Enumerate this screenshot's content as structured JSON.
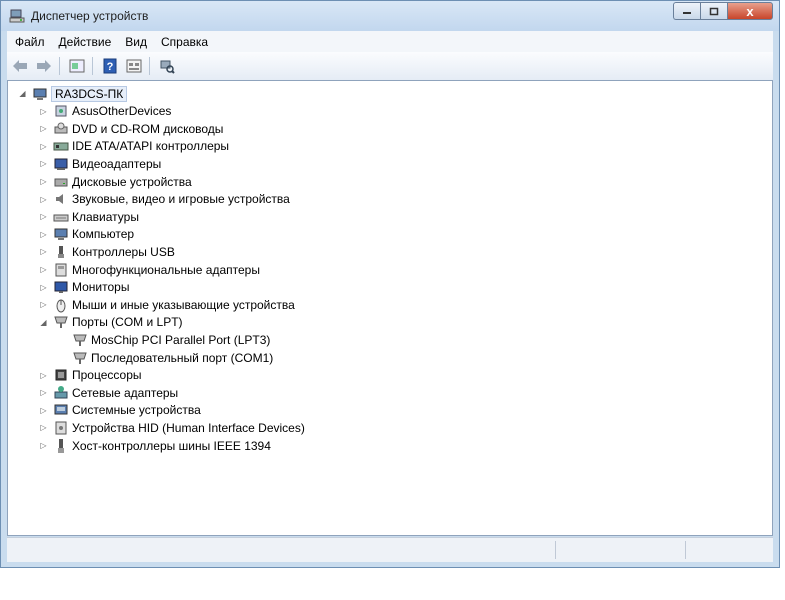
{
  "window": {
    "title": "Диспетчер устройств",
    "close_glyph": "x",
    "accent": "#c9dcee"
  },
  "menu": [
    "Файл",
    "Действие",
    "Вид",
    "Справка"
  ],
  "toolbar": {
    "buttons": [
      "back-icon",
      "forward-icon",
      "properties-icon",
      "help-icon",
      "view-icon",
      "scan-hardware-icon"
    ]
  },
  "tree": {
    "root": {
      "label": "RA3DCS-ПК",
      "expanded": true
    },
    "items": [
      {
        "label": "AsusOtherDevices",
        "icon": "device-icon",
        "expanded": false
      },
      {
        "label": "DVD и CD-ROM дисководы",
        "icon": "dvd-drive-icon",
        "expanded": false
      },
      {
        "label": "IDE ATA/ATAPI контроллеры",
        "icon": "ide-controller-icon",
        "expanded": false
      },
      {
        "label": "Видеоадаптеры",
        "icon": "display-adapter-icon",
        "expanded": false
      },
      {
        "label": "Дисковые устройства",
        "icon": "disk-drive-icon",
        "expanded": false
      },
      {
        "label": "Звуковые, видео и игровые устройства",
        "icon": "sound-icon",
        "expanded": false
      },
      {
        "label": "Клавиатуры",
        "icon": "keyboard-icon",
        "expanded": false
      },
      {
        "label": "Компьютер",
        "icon": "computer-icon",
        "expanded": false
      },
      {
        "label": "Контроллеры USB",
        "icon": "usb-icon",
        "expanded": false
      },
      {
        "label": "Многофункциональные адаптеры",
        "icon": "multifunction-adapter-icon",
        "expanded": false
      },
      {
        "label": "Мониторы",
        "icon": "monitor-icon",
        "expanded": false
      },
      {
        "label": "Мыши и иные указывающие устройства",
        "icon": "mouse-icon",
        "expanded": false
      },
      {
        "label": "Порты (COM и LPT)",
        "icon": "port-icon",
        "expanded": true,
        "children": [
          {
            "label": "MosChip PCI Parallel Port (LPT3)",
            "icon": "port-icon"
          },
          {
            "label": "Последовательный порт (COM1)",
            "icon": "port-icon"
          }
        ]
      },
      {
        "label": "Процессоры",
        "icon": "processor-icon",
        "expanded": false
      },
      {
        "label": "Сетевые адаптеры",
        "icon": "network-adapter-icon",
        "expanded": false
      },
      {
        "label": "Системные устройства",
        "icon": "system-device-icon",
        "expanded": false
      },
      {
        "label": "Устройства HID (Human Interface Devices)",
        "icon": "hid-icon",
        "expanded": false
      },
      {
        "label": "Хост-контроллеры шины IEEE 1394",
        "icon": "ieee1394-icon",
        "expanded": false
      }
    ]
  }
}
